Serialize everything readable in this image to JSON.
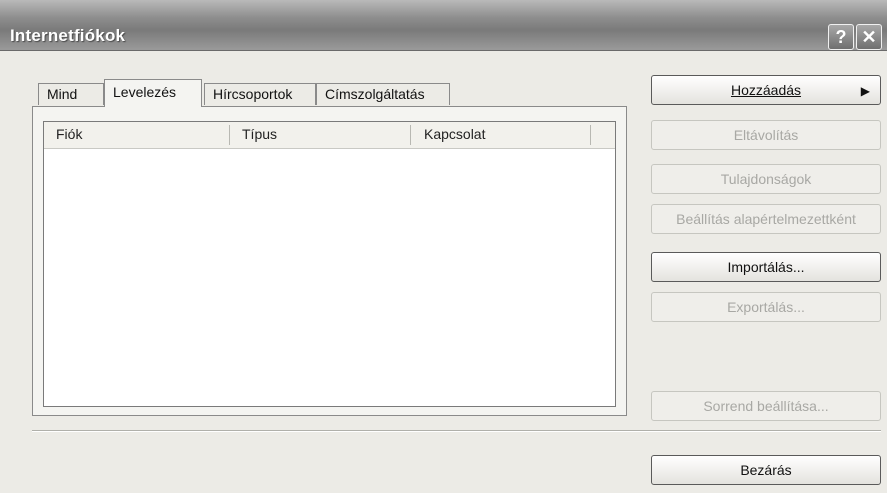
{
  "window": {
    "title": "Internetfiókok",
    "help_label": "?",
    "close_label": "✕"
  },
  "tabs": [
    {
      "label": "Mind",
      "active": false
    },
    {
      "label": "Levelezés",
      "active": true
    },
    {
      "label": "Hírcsoportok",
      "active": false
    },
    {
      "label": "Címszolgáltatás",
      "active": false
    }
  ],
  "list": {
    "columns": [
      "Fiók",
      "Típus",
      "Kapcsolat"
    ],
    "rows": []
  },
  "buttons": {
    "add": {
      "label": "Hozzáadás",
      "arrow": "▶",
      "enabled": true
    },
    "remove": {
      "label": "Eltávolítás",
      "enabled": false
    },
    "properties": {
      "label": "Tulajdonságok",
      "enabled": false
    },
    "set_default": {
      "label": "Beállítás alapértelmezettként",
      "enabled": false
    },
    "import": {
      "label": "Importálás...",
      "enabled": true
    },
    "export": {
      "label": "Exportálás...",
      "enabled": false
    },
    "set_order": {
      "label": "Sorrend beállítása...",
      "enabled": false
    },
    "close": {
      "label": "Bezárás",
      "enabled": true
    }
  }
}
